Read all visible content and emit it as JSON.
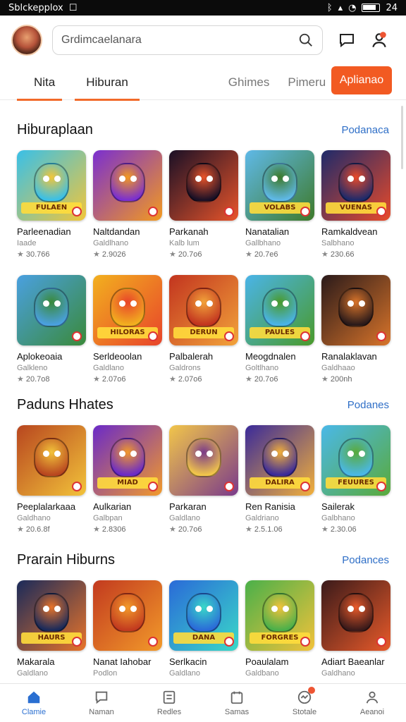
{
  "status_bar": {
    "left": "Sblckepplox",
    "time": "24"
  },
  "header": {
    "search_text": "Grdimcaelanara"
  },
  "tabs": [
    {
      "label": "Nita",
      "active": true
    },
    {
      "label": "Hiburan",
      "active": true
    },
    {
      "label": "Ghimes",
      "active": false
    },
    {
      "label": "Pimeru",
      "active": false
    }
  ],
  "apply_label": "Aplianao",
  "accent": "#f25a22",
  "link_color": "#2f6fc7",
  "sections": [
    {
      "title": "Hiburaplaan",
      "more": "Podanaca",
      "rows": [
        [
          {
            "name": "Parleenadian",
            "sub": "Iaade",
            "rating": "30.766",
            "colors": [
              "#39c0e8",
              "#f2c63a"
            ],
            "banner": "FULAEN"
          },
          {
            "name": "Naltdandan",
            "sub": "Galdlhano",
            "rating": "2.9026",
            "colors": [
              "#7a2fd0",
              "#f39a1f"
            ],
            "banner": ""
          },
          {
            "name": "Parkanah",
            "sub": "Kalb lum",
            "rating": "20.7o6",
            "colors": [
              "#1a1026",
              "#e8542a"
            ],
            "banner": ""
          },
          {
            "name": "Nanatalian",
            "sub": "Gallbhano",
            "rating": "20.7e6",
            "colors": [
              "#5fb9e8",
              "#3e7a2a"
            ],
            "banner": "VOLABS"
          },
          {
            "name": "Ramkaldvean",
            "sub": "Salbhano",
            "rating": "230.66",
            "colors": [
              "#1e2a6a",
              "#e84a2a"
            ],
            "banner": "VUENAS"
          }
        ],
        [
          {
            "name": "Aplokeoaia",
            "sub": "Galkleno",
            "rating": "20.7o8",
            "colors": [
              "#4aa0e0",
              "#3a8a3a"
            ],
            "banner": ""
          },
          {
            "name": "Serldeoolan",
            "sub": "Galdlano",
            "rating": "2.07o6",
            "colors": [
              "#f2b01f",
              "#e8442a"
            ],
            "banner": "HILORAS"
          },
          {
            "name": "Palbalerah",
            "sub": "Galdrons",
            "rating": "2.07o6",
            "colors": [
              "#c2341f",
              "#f2a33a"
            ],
            "banner": "DERUN"
          },
          {
            "name": "Meogdnalen",
            "sub": "Goltlhano",
            "rating": "20.7o6",
            "colors": [
              "#4ab4e8",
              "#4a9a2a"
            ],
            "banner": "PAULES"
          },
          {
            "name": "Ranalaklavan",
            "sub": "Galdhaao",
            "rating": "200nh",
            "colors": [
              "#2a1a1a",
              "#d8742a"
            ],
            "banner": ""
          }
        ]
      ]
    },
    {
      "title": "Paduns Hhates",
      "more": "Podanes",
      "rows": [
        [
          {
            "name": "Peeplalarkaaa",
            "sub": "Galdhano",
            "rating": "20.6.8f",
            "colors": [
              "#b8461f",
              "#f2c33a"
            ],
            "banner": ""
          },
          {
            "name": "Aulkarian",
            "sub": "Galbpan",
            "rating": "2.8306",
            "colors": [
              "#6a2ac8",
              "#f29a2a"
            ],
            "banner": "MIAD"
          },
          {
            "name": "Parkaran",
            "sub": "Galdlano",
            "rating": "20.7o6",
            "colors": [
              "#f2c64a",
              "#7a3a8a"
            ],
            "banner": ""
          },
          {
            "name": "Ren Ranisia",
            "sub": "Galdriano",
            "rating": "2.5.1.06",
            "colors": [
              "#3a2a9a",
              "#f2b03a"
            ],
            "banner": "DALIRA"
          },
          {
            "name": "Sailerak",
            "sub": "Galbhano",
            "rating": "2.30.06",
            "colors": [
              "#4ab8e8",
              "#5aaa3a"
            ],
            "banner": "FEUURES"
          }
        ]
      ]
    },
    {
      "title": "Prarain Hiburns",
      "more": "Podances",
      "rows": [
        [
          {
            "name": "Makarala",
            "sub": "Galdlano",
            "rating": "",
            "colors": [
              "#1a2a5a",
              "#e8742a"
            ],
            "banner": "HAURS"
          },
          {
            "name": "Nanat Iahobar",
            "sub": "Podlon",
            "rating": "",
            "colors": [
              "#c23a1f",
              "#f29a2a"
            ],
            "banner": ""
          },
          {
            "name": "Serlkacin",
            "sub": "Galdlano",
            "rating": "",
            "colors": [
              "#2a6ad8",
              "#3ad8c8"
            ],
            "banner": "DANA"
          },
          {
            "name": "Poaulalam",
            "sub": "Galdbano",
            "rating": "",
            "colors": [
              "#4ab04a",
              "#f2c23a"
            ],
            "banner": "FORGRES"
          },
          {
            "name": "Adiart Baeanlar",
            "sub": "Galdhano",
            "rating": "",
            "colors": [
              "#3a1a1a",
              "#e85a2a"
            ],
            "banner": ""
          }
        ]
      ]
    }
  ],
  "bottom_nav": [
    {
      "label": "Clamie",
      "icon": "home-icon",
      "active": true
    },
    {
      "label": "Naman",
      "icon": "chat-icon",
      "active": false
    },
    {
      "label": "Redles",
      "icon": "list-icon",
      "active": false
    },
    {
      "label": "Samas",
      "icon": "calendar-icon",
      "active": false
    },
    {
      "label": "Stotale",
      "icon": "stats-icon",
      "active": false
    },
    {
      "label": "Aeanoi",
      "icon": "profile-icon",
      "active": false
    }
  ]
}
